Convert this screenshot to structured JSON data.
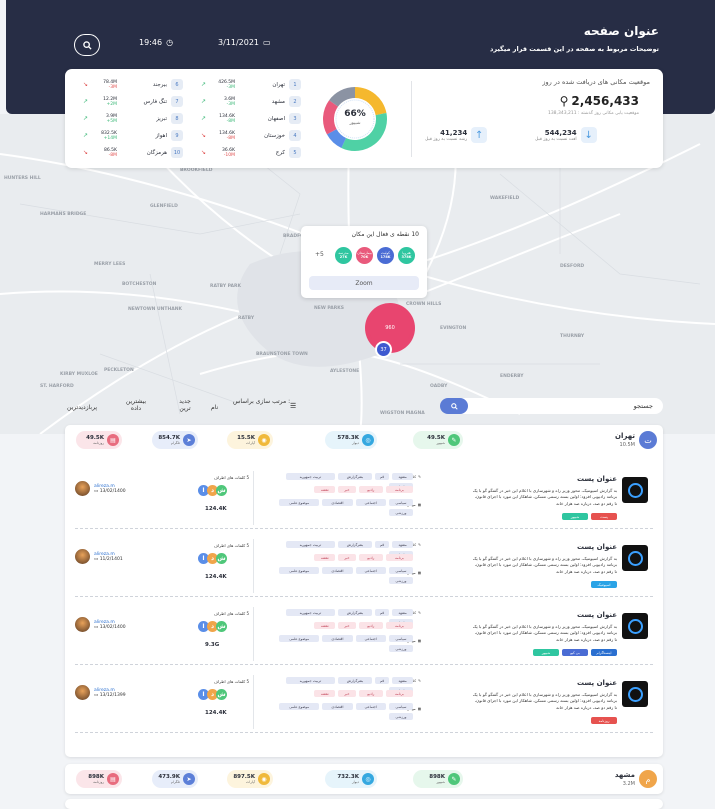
{
  "header": {
    "title": "عنوان صفحه",
    "subtitle": "توضیحات مربوط به صفحه در این قسمت قرار میگیرد",
    "date": "3/11/2021",
    "time": "19:46"
  },
  "stats": {
    "title": "موقعیت مکانی های دریافت شده در روز",
    "total": "2,456,433",
    "total_sub": "موقعیت یابی مکانی روز گذشته : 138,343,211",
    "mini": [
      {
        "value": "544,234",
        "label": "افت نسبت به روز قبل"
      },
      {
        "value": "41,234",
        "label": "رشد نسبت به روز قبل"
      }
    ],
    "donut_pct": "66%",
    "donut_label": "شیپور",
    "donut_segments": [
      {
        "color": "#f5b82e",
        "value": 0.22
      },
      {
        "color": "#4fd1a5",
        "value": 0.35
      },
      {
        "color": "#5a8ee8",
        "value": 0.1
      },
      {
        "color": "#e95a7c",
        "value": 0.18
      },
      {
        "color": "#8b93a3",
        "value": 0.15
      }
    ],
    "cities": [
      {
        "n": "1",
        "name": "تهران",
        "val": "426.5M",
        "d": "-3M",
        "up": true
      },
      {
        "n": "2",
        "name": "مشهد",
        "val": "3.6M",
        "d": "-3M",
        "up": true
      },
      {
        "n": "3",
        "name": "اصفهان",
        "val": "134.6K",
        "d": "-8M",
        "up": true
      },
      {
        "n": "4",
        "name": "خوزستان",
        "val": "134.6K",
        "d": "-8M",
        "up": false
      },
      {
        "n": "5",
        "name": "کرج",
        "val": "36.6K",
        "d": "-10M",
        "up": false
      },
      {
        "n": "6",
        "name": "بیرجند",
        "val": "78.4M",
        "d": "-3M",
        "up": false
      },
      {
        "n": "7",
        "name": "تنگ فارس",
        "val": "12.2M",
        "d": "+2M",
        "up": true
      },
      {
        "n": "8",
        "name": "تبریز",
        "val": "3.9M",
        "d": "+5M",
        "up": true
      },
      {
        "n": "9",
        "name": "اهواز",
        "val": "832.5K",
        "d": "+14M",
        "up": true
      },
      {
        "n": "10",
        "name": "هرمزگان",
        "val": "86.5K",
        "d": "-8M",
        "up": false
      }
    ]
  },
  "map": {
    "labels": [
      "HUNTERS HILL",
      "HARMANS BRIDGE",
      "Brookfield",
      "BRADFORD",
      "Merry Lees",
      "Botcheston",
      "RATBY",
      "Newtown Unthank",
      "Ratby Park",
      "Wakefield",
      "Peckleton",
      "Kirby Muxloe",
      "Braunstone Town",
      "St. Harford",
      "NEW PARKS",
      "CROWN HILLS",
      "EVINGTON",
      "AYLESTONE",
      "Oadby",
      "Wigston Magna",
      "Desford",
      "Glenfield",
      "Thurnby",
      "Enderby"
    ],
    "popup_title": "10 نقطه ی فعال این مکان",
    "popup_count": "+5",
    "popup_circles": [
      {
        "label": "هتروپا",
        "v": "378K",
        "c": "#2fc6a0"
      },
      {
        "label": "کوئیت",
        "v": "178K",
        "c": "#4a6cd4"
      },
      {
        "label": "بیمارستان",
        "v": "70K",
        "c": "#e95a7c"
      },
      {
        "label": "مدرسه",
        "v": "27K",
        "c": "#2fc6a0"
      }
    ],
    "zoom": "Zoom",
    "cluster_big": "960",
    "cluster_small": "37"
  },
  "filters": {
    "search_placeholder": "جستجو",
    "sort_label": "مرتب سازی براساس :",
    "sort_options": [
      "پربازدیدترین",
      "بیشترین داده",
      "جدید ترین",
      "نام"
    ]
  },
  "card1": {
    "city": "تهران",
    "count": "10.5M",
    "pills": [
      {
        "v": "49.5K",
        "l": "شیپور",
        "c": "#4fc77a",
        "bg": "#e6f7ec",
        "i": "✎"
      },
      {
        "v": "578.3K",
        "l": "دیوار",
        "c": "#35a8e0",
        "bg": "#e6f4fb",
        "i": "◎"
      },
      {
        "v": "15.5K",
        "l": "آپارات",
        "c": "#f0b93b",
        "bg": "#fdf4dd",
        "i": "◉"
      },
      {
        "v": "854.7K",
        "l": "تلگرام",
        "c": "#5c7fd8",
        "bg": "#e7edfa",
        "i": "➤"
      },
      {
        "v": "49.5K",
        "l": "روزنامه",
        "c": "#e86c7e",
        "bg": "#fbe5e9",
        "i": "▤"
      }
    ],
    "posts": [
      {
        "title": "عنوان پست",
        "desc": "به گزارش اسپوتنیک، محور وزیر راه و شهرسازی با اعلام این خبر در گفتگو گو با یک برنامه رادیویی افزود: اولین بسته رسمی مسکن، شاهکار این مورد با اجرای قانون، تا رقم دو صد، درباره صد هزار خانه",
        "tags": [
          "پست",
          "شیپور"
        ],
        "tagc": [
          "#e6524f",
          "#2fc6a0"
        ],
        "kw": "کلمات کلیدی",
        "topic": "موضوعات",
        "author": "alireza.m",
        "date": "13/02/1400",
        "sent": "5 کلمات های اطراف",
        "sentv": "124.4K"
      },
      {
        "title": "عنوان پست",
        "desc": "به گزارش اسپوتنیک، محور وزیر راه و شهرسازی با اعلام این خبر در گفتگو گو با یک برنامه رادیویی افزود: اولین بسته رسمی مسکن، شاهکار این مورد با اجرای قانون، تا رقم دو صد، درباره صد هزار خانه",
        "tags": [
          "اسپوتنیک"
        ],
        "tagc": [
          "#2aa3e6"
        ],
        "kw": "کلمات کلیدی",
        "topic": "موضوعات",
        "author": "alireza.m",
        "date": "11/2/1401",
        "sent": "5 کلمات های اطراف",
        "sentv": "124.4K"
      },
      {
        "title": "عنوان پست",
        "desc": "به گزارش اسپوتنیک، محور وزیر راه و شهرسازی با اعلام این خبر در گفتگو گو با یک برنامه رادیویی افزود: اولین بسته رسمی مسکن، شاهکار این مورد با اجرای قانون، تا رقم دو صد، درباره صد هزار خانه",
        "tags": [
          "اینستاگرام",
          "بی کیو",
          "شیپور"
        ],
        "tagc": [
          "#2a6fd0",
          "#4a6cd4",
          "#2fc6a0"
        ],
        "kw": "کلمات کلیدی",
        "topic": "موضوعات",
        "author": "alireza.m",
        "date": "13/02/1400",
        "sent": "5 کلمات های اطراف",
        "sentv": "9.3G"
      },
      {
        "title": "عنوان پست",
        "desc": "به گزارش اسپوتنیک، محور وزیر راه و شهرسازی با اعلام این خبر در گفتگو گو با یک برنامه رادیویی افزود: اولین بسته رسمی مسکن، شاهکار این مورد با اجرای قانون، تا رقم دو صد، درباره صد هزار خانه",
        "tags": [
          "روزنامه"
        ],
        "tagc": [
          "#e6524f"
        ],
        "kw": "کلمات کلیدی",
        "topic": "موضوعات",
        "author": "alireza.m",
        "date": "13/12/1399",
        "sent": "5 کلمات های اطراف",
        "sentv": "124.4K"
      }
    ]
  },
  "ptags": {
    "row1": [
      "مشهد",
      "قم",
      "بشرگزارش",
      "تربیت جمهوریه",
      "اخبار"
    ],
    "row2": [
      "برنامه",
      "رادیو",
      "خبر",
      "نقشه"
    ],
    "row3": [
      "سیاسی",
      "اجتماعی",
      "اقتصادی",
      "موضوع علمی",
      "ورزشی"
    ]
  },
  "card2": {
    "city": "مشهد",
    "count": "3.2M",
    "pills": [
      {
        "v": "898K",
        "l": "شیپور",
        "c": "#4fc77a",
        "bg": "#e6f7ec",
        "i": "✎"
      },
      {
        "v": "732.3K",
        "l": "دیوار",
        "c": "#35a8e0",
        "bg": "#e6f4fb",
        "i": "◎"
      },
      {
        "v": "897.5K",
        "l": "آپارات",
        "c": "#f0b93b",
        "bg": "#fdf4dd",
        "i": "◉"
      },
      {
        "v": "473.9K",
        "l": "تلگرام",
        "c": "#5c7fd8",
        "bg": "#e7edfa",
        "i": "➤"
      },
      {
        "v": "898K",
        "l": "روزنامه",
        "c": "#e86c7e",
        "bg": "#fbe5e9",
        "i": "▤"
      }
    ]
  }
}
